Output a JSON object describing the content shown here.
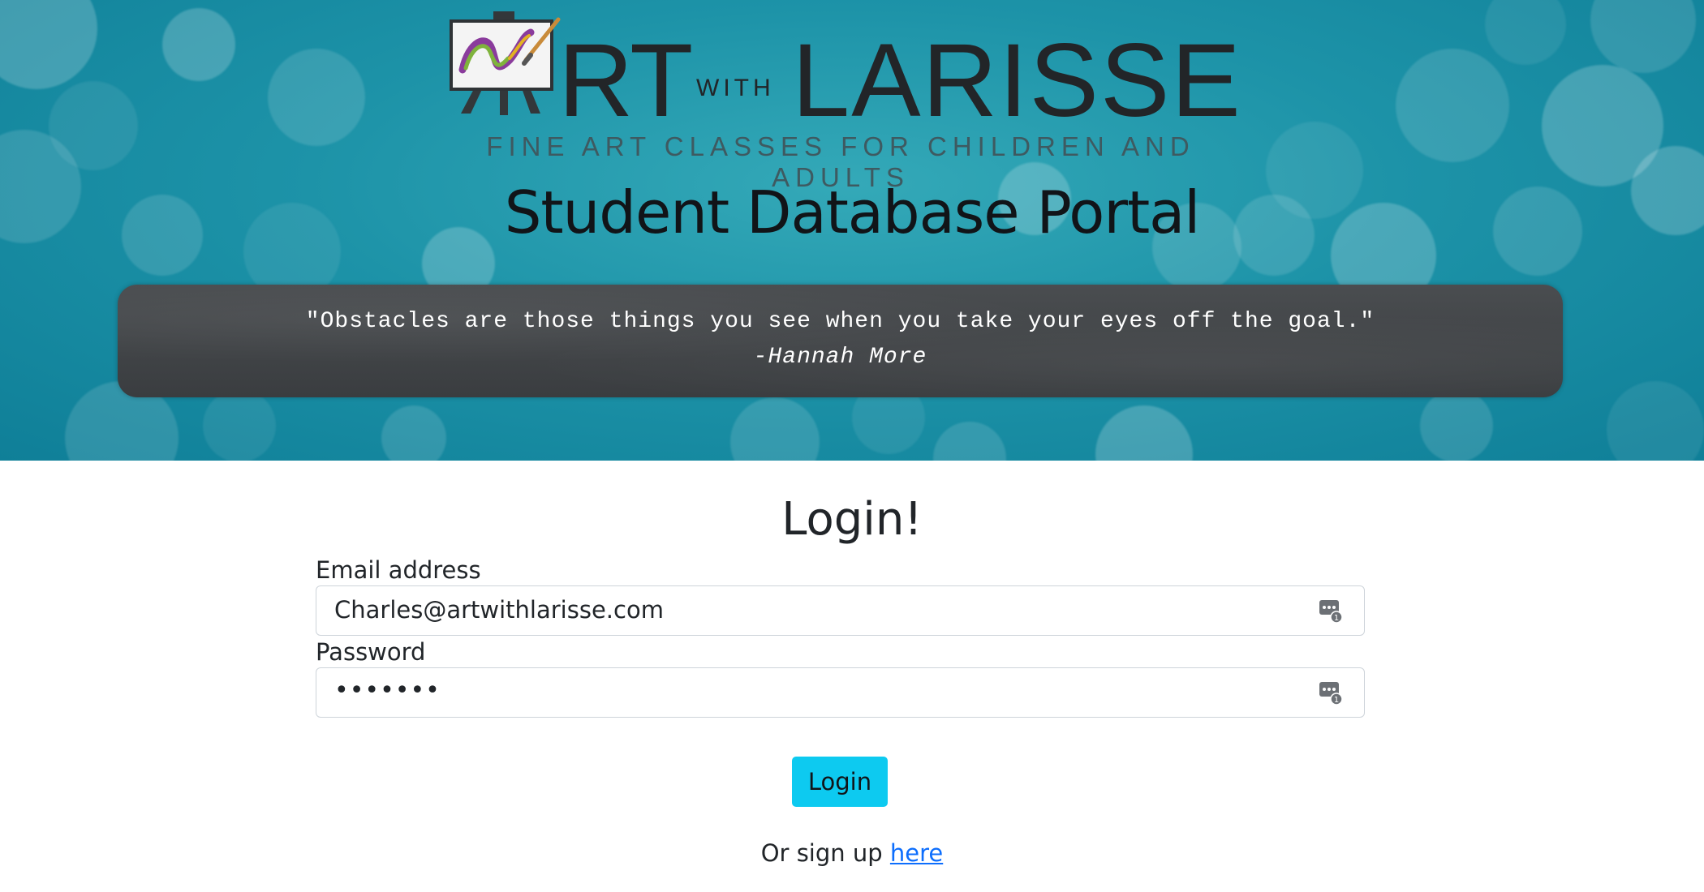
{
  "header": {
    "logo": {
      "word_rt": "RT",
      "word_with": "WITH",
      "word_larisse": "LARISSE",
      "tagline": "FINE ART CLASSES FOR CHILDREN AND ADULTS"
    },
    "portal_title": "Student Database Portal",
    "quote": {
      "text": "\"Obstacles are those things you see when you take your eyes off the goal.\"",
      "author": "-Hannah More"
    }
  },
  "login": {
    "heading": "Login!",
    "email": {
      "label": "Email address",
      "value": "Charles@artwithlarisse.com",
      "icon": "password-manager-icon"
    },
    "password": {
      "label": "Password",
      "value": "•••••••",
      "icon": "password-manager-icon"
    },
    "submit_label": "Login",
    "signup_prefix": "Or sign up ",
    "signup_link": "here"
  },
  "colors": {
    "hero_teal": "#1d93a8",
    "quote_box": "#3f4245",
    "button": "#0dcaf0",
    "link": "#0d6efd"
  }
}
